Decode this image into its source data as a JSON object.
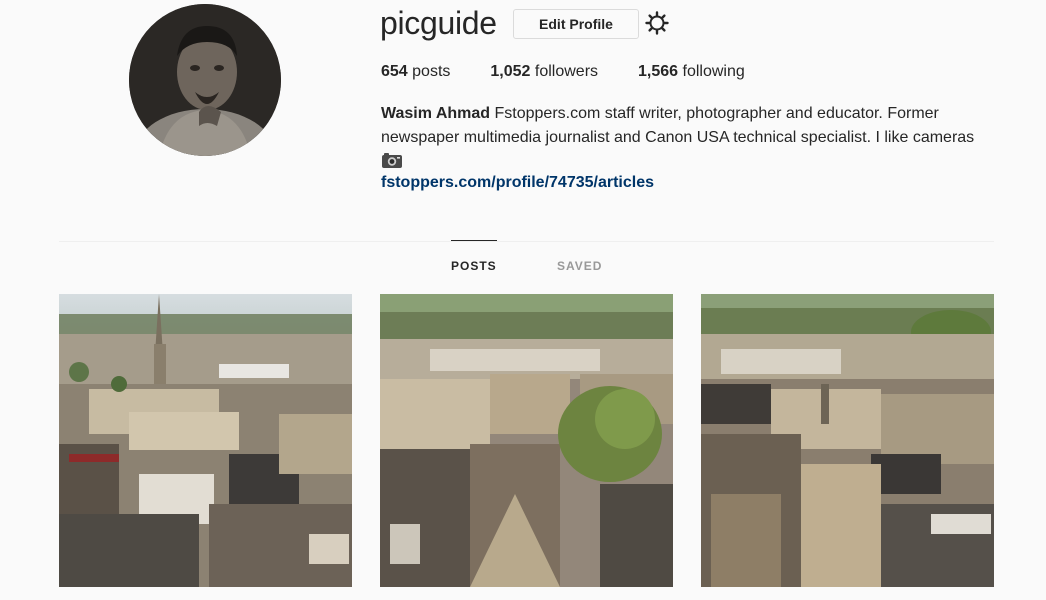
{
  "profile": {
    "username": "picguide",
    "edit_label": "Edit Profile",
    "stats": {
      "posts_count": "654",
      "posts_label": " posts",
      "followers_count": "1,052",
      "followers_label": " followers",
      "following_count": "1,566",
      "following_label": " following"
    },
    "bio": {
      "name": "Wasim Ahmad",
      "text": " Fstoppers.com staff writer, photographer and educator. Former newspaper multimedia journalist and Canon USA technical specialist. I like cameras",
      "emoji": "camera-icon",
      "link": "fstoppers.com/profile/74735/articles"
    }
  },
  "tabs": [
    {
      "label": "POSTS",
      "active": true
    },
    {
      "label": "SAVED",
      "active": false
    }
  ],
  "colors": {
    "link": "#003569",
    "text": "#262626",
    "muted": "#999999",
    "background": "#fafafa"
  },
  "posts": [
    {
      "subject": "aerial city view with church spire"
    },
    {
      "subject": "aerial city view with green tree"
    },
    {
      "subject": "aerial city view with rooftops"
    }
  ]
}
